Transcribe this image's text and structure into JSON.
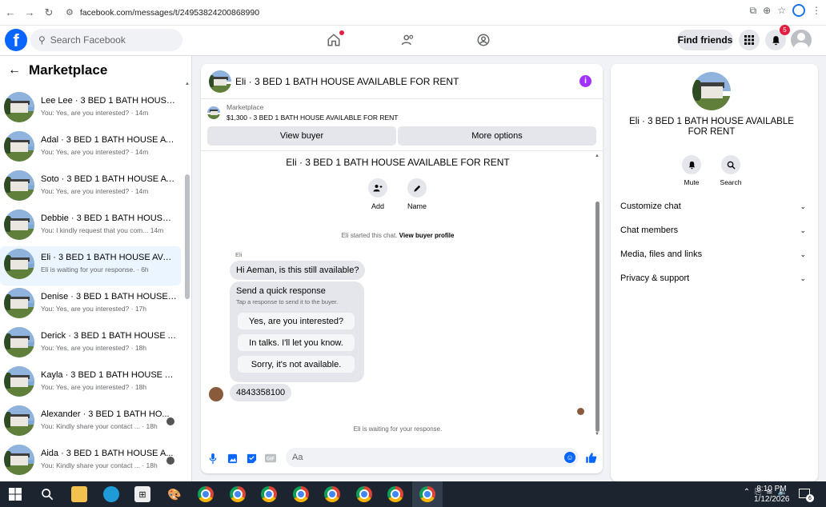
{
  "browser": {
    "url": "facebook.com/messages/t/24953824200868990"
  },
  "header": {
    "search_placeholder": "Search Facebook",
    "find_friends": "Find friends",
    "notification_count": "5"
  },
  "sidebar": {
    "title": "Marketplace",
    "conversations": [
      {
        "name": "Lee Lee · 3 BED 1 BATH HOUSE A...",
        "preview": "You: Yes, are you interested? · 14m"
      },
      {
        "name": "Adal · 3 BED 1 BATH HOUSE AVA...",
        "preview": "You: Yes, are you interested? · 14m"
      },
      {
        "name": "Soto · 3 BED 1 BATH HOUSE AVA...",
        "preview": "You: Yes, are you interested? · 14m"
      },
      {
        "name": "Debbie · 3 BED 1 BATH HOUSE A...",
        "preview": "You: I kindly request that you com... 14m"
      },
      {
        "name": "Eli · 3 BED 1 BATH HOUSE AVAIL...",
        "preview": "Eli is waiting for your response. · 6h"
      },
      {
        "name": "Denise · 3 BED 1 BATH HOUSE A...",
        "preview": "You: Yes, are you interested? · 17h"
      },
      {
        "name": "Derick · 3 BED 1 BATH HOUSE AV...",
        "preview": "You: Yes, are you interested? · 18h"
      },
      {
        "name": "Kayla · 3 BED 1 BATH HOUSE AV...",
        "preview": "You: Yes, are you interested? · 18h"
      },
      {
        "name": "Alexander · 3 BED 1 BATH HO...",
        "preview": "You: Kindly share your contact ... · 18h"
      },
      {
        "name": "Aida · 3 BED 1 BATH HOUSE A...",
        "preview": "You: Kindly share your contact ... · 18h"
      }
    ]
  },
  "chat": {
    "title": "Eli · 3 BED 1 BATH HOUSE AVAILABLE FOR RENT",
    "marketplace_label": "Marketplace",
    "listing": "$1,300 - 3 BED 1 BATH HOUSE AVAILABLE FOR RENT",
    "view_buyer": "View buyer",
    "more_options": "More options",
    "body_title": "Eli · 3 BED 1 BATH HOUSE AVAILABLE FOR RENT",
    "add_label": "Add",
    "name_label": "Name",
    "started_text": "Eli started this chat.",
    "view_profile": "View buyer profile",
    "sender": "Eli",
    "message1": "Hi Aeman, is this still available?",
    "quick_title": "Send a quick response",
    "quick_sub": "Tap a response to send it to the buyer.",
    "quick_responses": [
      "Yes, are you interested?",
      "In talks. I'll let you know.",
      "Sorry, it's not available."
    ],
    "message2": "4843358100",
    "waiting": "Eli is waiting for your response.",
    "input_placeholder": "Aa"
  },
  "details": {
    "title": "Eli · 3 BED 1 BATH HOUSE AVAILABLE FOR RENT",
    "mute": "Mute",
    "search": "Search",
    "sections": [
      "Customize chat",
      "Chat members",
      "Media, files and links",
      "Privacy & support"
    ]
  },
  "taskbar": {
    "time": "8:10 PM",
    "date": "1/12/2026",
    "notif_count": "6"
  },
  "colors": {
    "brand": "#0866ff",
    "info": "#a033ff",
    "badge": "#e41e3f"
  }
}
